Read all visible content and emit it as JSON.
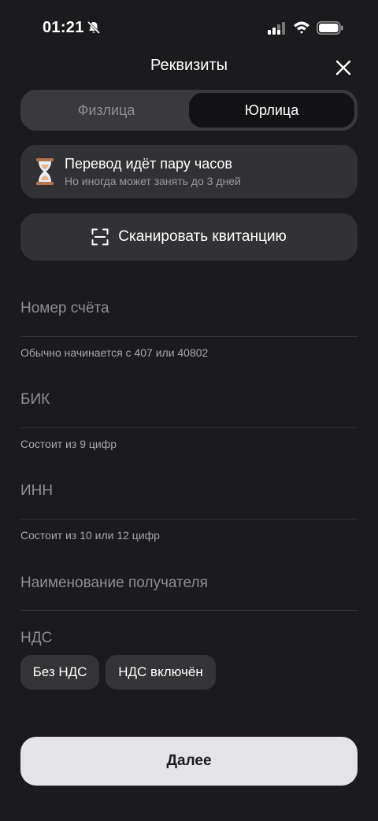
{
  "status_bar": {
    "time": "01:21",
    "icons": [
      "bell-slash-icon",
      "cellular-signal-icon",
      "wifi-icon",
      "battery-icon"
    ]
  },
  "header": {
    "title": "Реквизиты",
    "close_icon": "close-icon"
  },
  "segment": {
    "options": [
      "Физлица",
      "Юрлица"
    ],
    "selected": "Юрлица"
  },
  "info_card": {
    "icon": "hourglass-icon",
    "title": "Перевод идёт пару часов",
    "subtitle": "Но иногда может занять до 3 дней"
  },
  "scan_button": {
    "icon": "scan-frame-icon",
    "label": "Сканировать квитанцию"
  },
  "fields": {
    "account": {
      "value": "",
      "placeholder": "Номер счёта",
      "hint": "Обычно начинается с 407 или 40802"
    },
    "bik": {
      "value": "",
      "placeholder": "БИК",
      "hint": "Состоит из 9 цифр"
    },
    "inn": {
      "value": "",
      "placeholder": "ИНН",
      "hint": "Состоит из 10 или 12 цифр"
    },
    "recipient": {
      "value": "",
      "placeholder": "Наименование получателя"
    }
  },
  "nds": {
    "label": "НДС",
    "options": [
      "Без НДС",
      "НДС включён"
    ]
  },
  "next_button": {
    "label": "Далее"
  },
  "colors": {
    "background": "#1b1b1d",
    "card": "#323235",
    "primary_button": "#e4e4e8"
  }
}
